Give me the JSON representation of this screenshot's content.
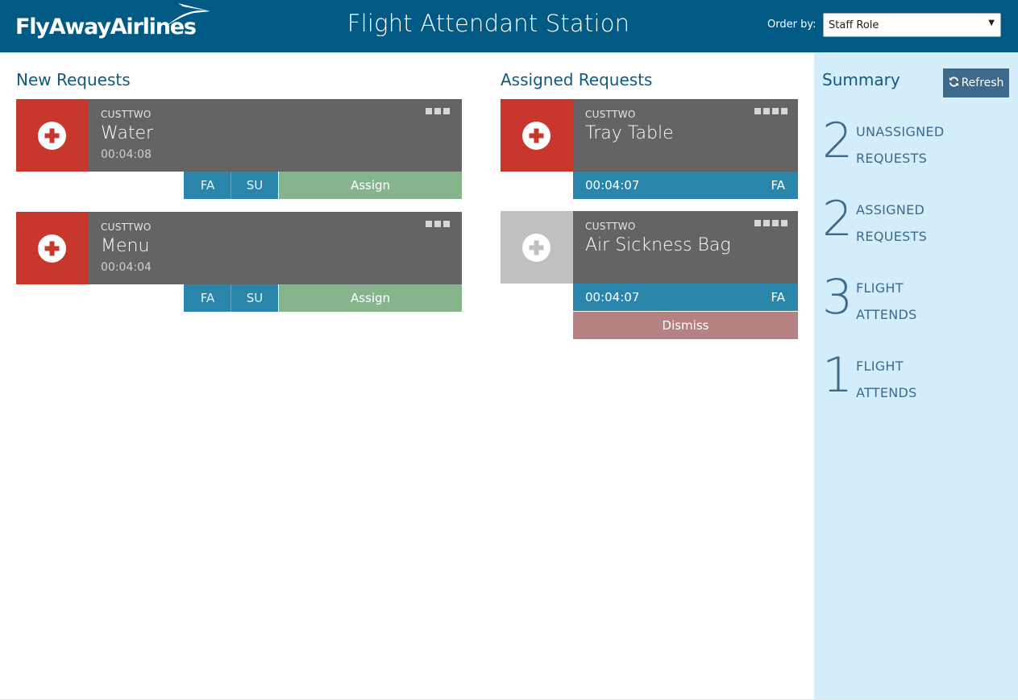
{
  "header": {
    "logo_text": "FlyAwayAirlines",
    "title": "Flight Attendant Station",
    "order_label": "Order by:",
    "order_value": "Staff Role"
  },
  "sections": {
    "new_title": "New Requests",
    "assigned_title": "Assigned Requests"
  },
  "new_requests": [
    {
      "customer": "CUSTTWO",
      "item": "Water",
      "time": "00:04:08",
      "btn_fa": "FA",
      "btn_su": "SU",
      "btn_assign": "Assign"
    },
    {
      "customer": "CUSTTWO",
      "item": "Menu",
      "time": "00:04:04",
      "btn_fa": "FA",
      "btn_su": "SU",
      "btn_assign": "Assign"
    }
  ],
  "assigned_requests": [
    {
      "customer": "CUSTTWO",
      "item": "Tray Table",
      "time": "00:04:07",
      "role": "FA"
    },
    {
      "customer": "CUSTTWO",
      "item": "Air Sickness Bag",
      "time": "00:04:07",
      "role": "FA",
      "dismiss": "Dismiss"
    }
  ],
  "summary": {
    "title": "Summary",
    "refresh_label": "Refresh",
    "stats": [
      {
        "number": "2",
        "line1": "UNASSIGNED",
        "line2": "REQUESTS"
      },
      {
        "number": "2",
        "line1": "ASSIGNED",
        "line2": "REQUESTS"
      },
      {
        "number": "3",
        "line1": "FLIGHT",
        "line2": "ATTENDS"
      },
      {
        "number": "1",
        "line1": "FLIGHT",
        "line2": "ATTENDS"
      }
    ]
  },
  "colors": {
    "header_bg": "#005a84",
    "urgent_red": "#c8372d",
    "card_grey": "#646464",
    "role_blue": "#2a85aa",
    "assign_green": "#86b58d",
    "dismiss_rose": "#b58283",
    "sidebar_bg": "#d4edfb"
  },
  "icons": {
    "request": "plus-circle-icon",
    "menu": "dots-menu-icon",
    "refresh": "refresh-icon",
    "dropdown": "chevron-down-icon"
  }
}
